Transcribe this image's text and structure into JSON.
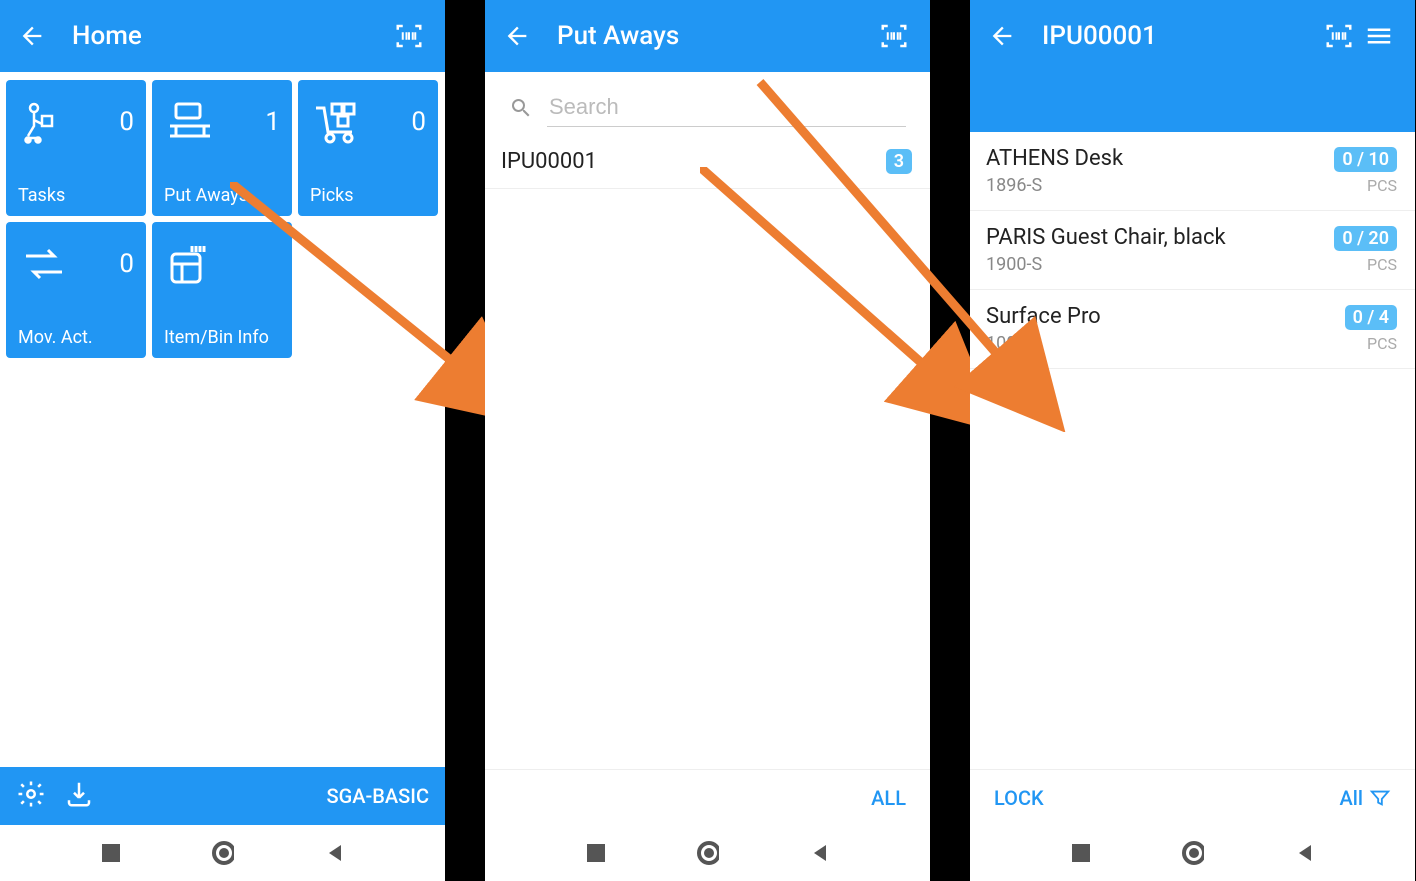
{
  "screen1": {
    "title": "Home",
    "tiles": [
      {
        "label": "Tasks",
        "count": "0"
      },
      {
        "label": "Put Aways",
        "count": "1"
      },
      {
        "label": "Picks",
        "count": "0"
      },
      {
        "label": "Mov. Act.",
        "count": "0"
      },
      {
        "label": "Item/Bin Info",
        "count": ""
      }
    ],
    "footer_text": "SGA-BASIC"
  },
  "screen2": {
    "title": "Put Aways",
    "search_placeholder": "Search",
    "items": [
      {
        "code": "IPU00001",
        "badge": "3"
      }
    ],
    "footer_action": "ALL"
  },
  "screen3": {
    "title": "IPU00001",
    "items": [
      {
        "name": "ATHENS Desk",
        "code": "1896-S",
        "badge": "0 / 10",
        "unit": "PCS"
      },
      {
        "name": "PARIS Guest Chair, black",
        "code": "1900-S",
        "badge": "0 / 20",
        "unit": "PCS"
      },
      {
        "name": "Surface Pro",
        "code": "1000",
        "badge": "0 / 4",
        "unit": "PCS"
      }
    ],
    "footer_left": "LOCK",
    "footer_right": "All"
  }
}
